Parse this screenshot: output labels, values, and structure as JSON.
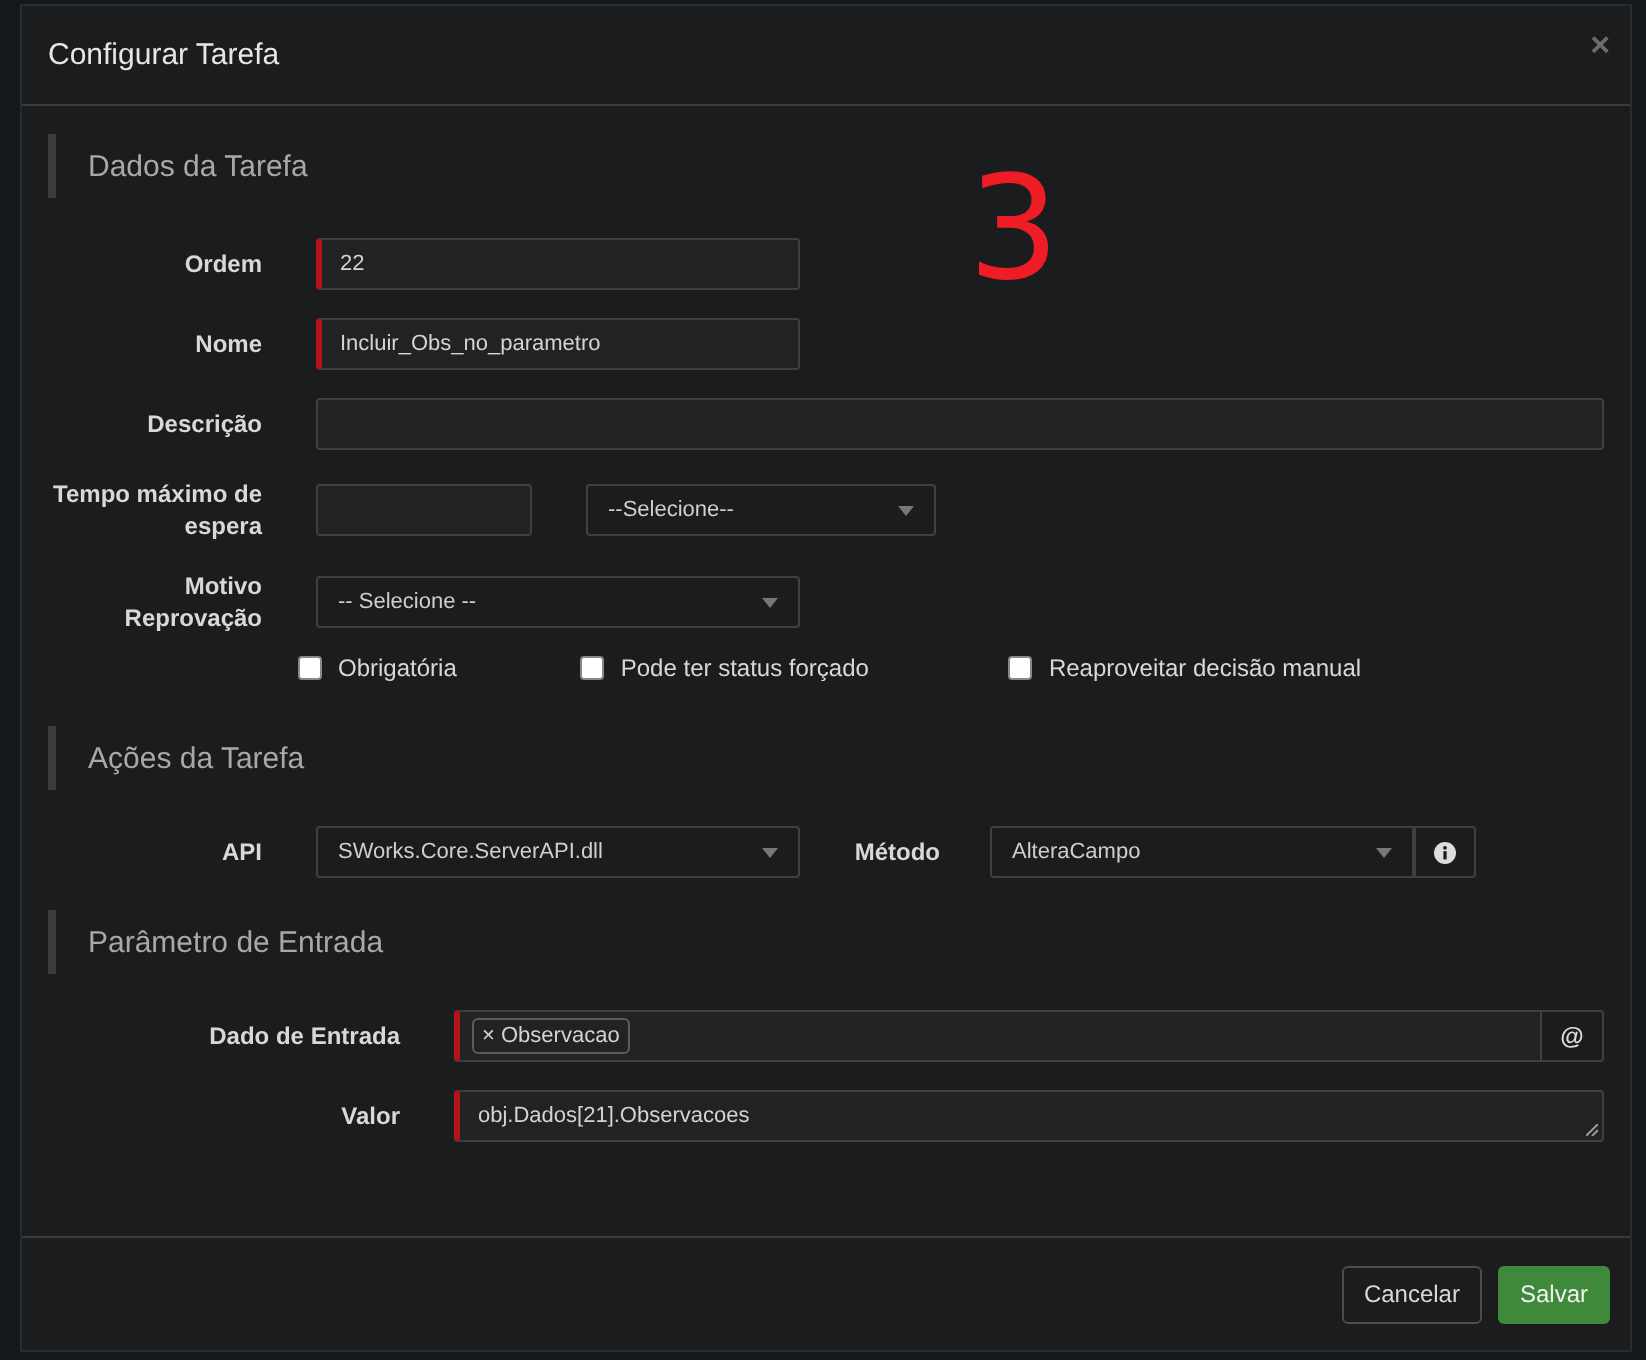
{
  "dialog": {
    "title": "Configurar Tarefa",
    "close": "×"
  },
  "annotation": "3",
  "sections": [
    {
      "title": "Dados da Tarefa",
      "rows": [
        {
          "kind": "short_text",
          "label": "Ordem",
          "value": "22",
          "required": true
        },
        {
          "kind": "short_text",
          "label": "Nome",
          "value": "Incluir_Obs_no_parametro",
          "required": true
        },
        {
          "kind": "long_text",
          "label": "Descrição",
          "required": false
        },
        {
          "kind": "duration",
          "label": "Tempo máximo de espera",
          "value": "",
          "select": "--Selecione--"
        },
        {
          "kind": "select",
          "label": "Motivo Reprovação",
          "value": "-- Selecione --"
        },
        {
          "kind": "checks",
          "items": [
            {
              "label": "Obrigatória",
              "checked": false
            },
            {
              "label": "Pode ter status forçado",
              "checked": false
            },
            {
              "label": "Reaproveitar decisão manual",
              "checked": false
            }
          ]
        }
      ]
    },
    {
      "title": "Ações da Tarefa",
      "rows": [
        {
          "kind": "api",
          "label": "API",
          "value": "SWorks.Core.ServerAPI.dll",
          "method_label": "Método",
          "method": "AlteraCampo"
        }
      ]
    },
    {
      "title": "Parâmetro de Entrada",
      "rows": [
        {
          "kind": "tags",
          "label": "Dado de Entrada",
          "tags": [
            {
              "remove": "×",
              "label": "Observacao"
            }
          ],
          "required": true,
          "addon": "@"
        },
        {
          "kind": "textarea",
          "label": "Valor",
          "value": "obj.Dados[21].Observacoes",
          "required": true
        }
      ]
    }
  ],
  "buttons": [
    {
      "label": "Cancelar",
      "kind": "default"
    },
    {
      "label": "Salvar",
      "kind": "primary"
    }
  ]
}
